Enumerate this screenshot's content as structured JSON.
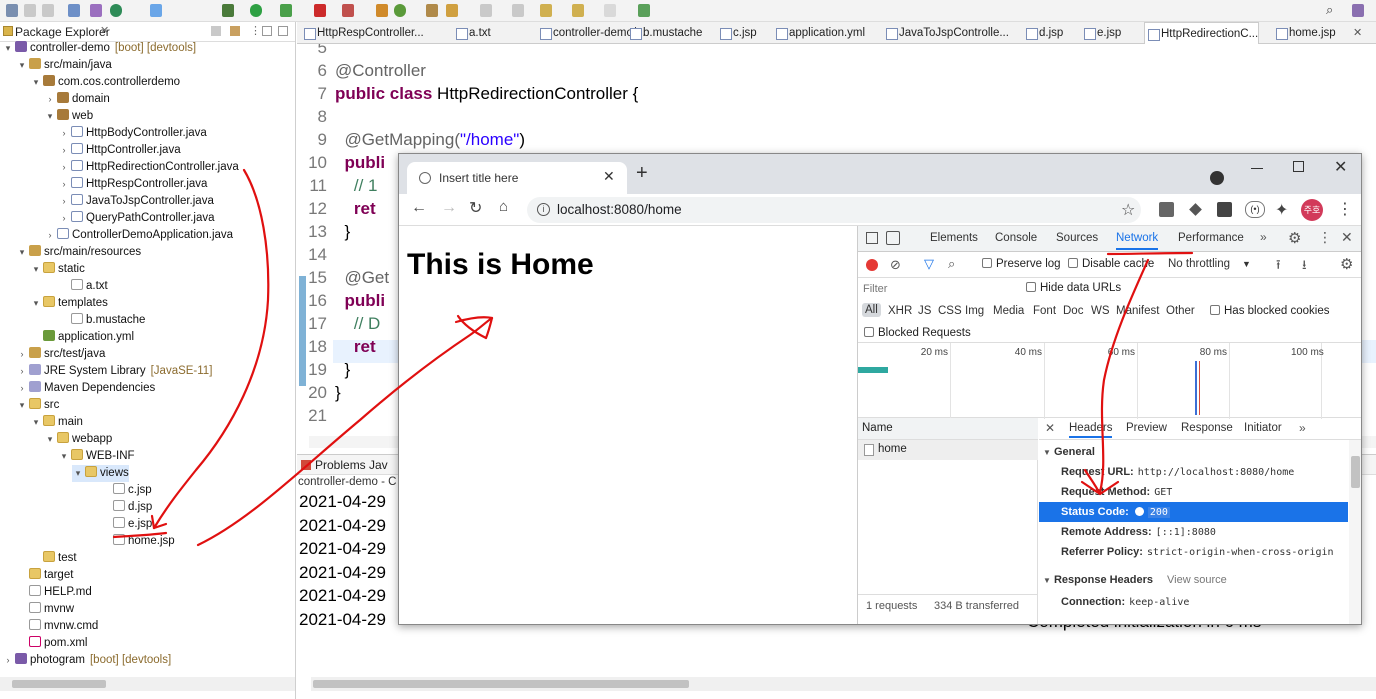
{
  "package_explorer": {
    "title": "Package Explorer",
    "items": [
      {
        "label": "controller-demo",
        "decor": "[boot] [devtools]"
      },
      {
        "label": "src/main/java"
      },
      {
        "label": "com.cos.controllerdemo"
      },
      {
        "label": "domain"
      },
      {
        "label": "web"
      },
      {
        "label": "HttpBodyController.java"
      },
      {
        "label": "HttpController.java"
      },
      {
        "label": "HttpRedirectionController.java"
      },
      {
        "label": "HttpRespController.java"
      },
      {
        "label": "JavaToJspController.java"
      },
      {
        "label": "QueryPathController.java"
      },
      {
        "label": "ControllerDemoApplication.java"
      },
      {
        "label": "src/main/resources"
      },
      {
        "label": "static"
      },
      {
        "label": "a.txt"
      },
      {
        "label": "templates"
      },
      {
        "label": "b.mustache"
      },
      {
        "label": "application.yml"
      },
      {
        "label": "src/test/java"
      },
      {
        "label": "JRE System Library",
        "decor": "[JavaSE-11]"
      },
      {
        "label": "Maven Dependencies"
      },
      {
        "label": "src"
      },
      {
        "label": "main"
      },
      {
        "label": "webapp"
      },
      {
        "label": "WEB-INF"
      },
      {
        "label": "views"
      },
      {
        "label": "c.jsp"
      },
      {
        "label": "d.jsp"
      },
      {
        "label": "e.jsp"
      },
      {
        "label": "home.jsp"
      },
      {
        "label": "test"
      },
      {
        "label": "target"
      },
      {
        "label": "HELP.md"
      },
      {
        "label": "mvnw"
      },
      {
        "label": "mvnw.cmd"
      },
      {
        "label": "pom.xml"
      },
      {
        "label": "photogram",
        "decor": "[boot] [devtools]"
      }
    ]
  },
  "editor_tabs": [
    "HttpRespController...",
    "a.txt",
    "controller-demo/...",
    "b.mustache",
    "c.jsp",
    "application.yml",
    "JavaToJspControlle...",
    "d.jsp",
    "e.jsp",
    "HttpRedirectionC...",
    "home.jsp"
  ],
  "editor": {
    "lines": [
      {
        "num": "5",
        "parts": []
      },
      {
        "num": "6",
        "parts": [
          {
            "t": "@Controller",
            "c": "ann"
          }
        ]
      },
      {
        "num": "7",
        "parts": [
          {
            "t": "public class ",
            "c": "kw"
          },
          {
            "t": "HttpRedirectionController {",
            "c": ""
          }
        ]
      },
      {
        "num": "8",
        "parts": []
      },
      {
        "num": "9",
        "parts": [
          {
            "t": "  @GetMapping(",
            "c": "ann"
          },
          {
            "t": "\"/home\"",
            "c": "str"
          },
          {
            "t": ")",
            "c": ""
          }
        ]
      },
      {
        "num": "10",
        "parts": [
          {
            "t": "  publi",
            "c": "kw"
          }
        ]
      },
      {
        "num": "11",
        "parts": [
          {
            "t": "    // 1",
            "c": "cm"
          }
        ]
      },
      {
        "num": "12",
        "parts": [
          {
            "t": "    ret",
            "c": "kw"
          }
        ]
      },
      {
        "num": "13",
        "parts": [
          {
            "t": "  }",
            "c": ""
          }
        ]
      },
      {
        "num": "14",
        "parts": []
      },
      {
        "num": "15",
        "parts": [
          {
            "t": "  @Get",
            "c": "ann"
          }
        ]
      },
      {
        "num": "16",
        "parts": [
          {
            "t": "  publi",
            "c": "kw"
          }
        ]
      },
      {
        "num": "17",
        "parts": [
          {
            "t": "    // D",
            "c": "cm"
          }
        ]
      },
      {
        "num": "18",
        "parts": [
          {
            "t": "    ret",
            "c": "kw"
          }
        ]
      },
      {
        "num": "19",
        "parts": [
          {
            "t": "  }",
            "c": ""
          }
        ]
      },
      {
        "num": "20",
        "parts": [
          {
            "t": "}",
            "c": ""
          }
        ]
      },
      {
        "num": "21",
        "parts": []
      }
    ]
  },
  "console": {
    "tabs": [
      "Problems",
      "Jav"
    ],
    "header": "controller-demo - C",
    "lines": [
      "2021-04-29",
      "2021-04-29",
      "2021-04-29",
      "2021-04-29",
      "2021-04-29",
      "2021-04-29"
    ],
    "last_line_suffix": "Completed initialization in 6 ms"
  },
  "browser": {
    "tab_title": "Insert title here",
    "url": "localhost:8080/home",
    "avatar_text": "주호",
    "page_heading": "This is Home",
    "devtools": {
      "tabs": [
        "Elements",
        "Console",
        "Sources",
        "Network",
        "Performance"
      ],
      "active_tab": "Network",
      "preserve_log": "Preserve log",
      "disable_cache": "Disable cache",
      "throttling": "No throttling",
      "filter_placeholder": "Filter",
      "hide_data_urls": "Hide data URLs",
      "type_filters": [
        "All",
        "XHR",
        "JS",
        "CSS",
        "Img",
        "Media",
        "Font",
        "Doc",
        "WS",
        "Manifest",
        "Other"
      ],
      "has_blocked_cookies": "Has blocked cookies",
      "blocked_requests": "Blocked Requests",
      "timeline_ticks": [
        "20 ms",
        "40 ms",
        "60 ms",
        "80 ms",
        "100 ms"
      ],
      "name_header": "Name",
      "requests": [
        "home"
      ],
      "status_bar": {
        "requests": "1 requests",
        "transferred": "334 B transferred"
      },
      "detail_tabs": [
        "Headers",
        "Preview",
        "Response",
        "Initiator"
      ],
      "general_title": "General",
      "general": [
        {
          "key": "Request URL:",
          "value": "http://localhost:8080/home"
        },
        {
          "key": "Request Method:",
          "value": "GET"
        },
        {
          "key": "Status Code:",
          "value": "200"
        },
        {
          "key": "Remote Address:",
          "value": "[::1]:8080"
        },
        {
          "key": "Referrer Policy:",
          "value": "strict-origin-when-cross-origin"
        }
      ],
      "response_headers_title": "Response Headers",
      "view_source": "View source",
      "response_headers": [
        {
          "key": "Connection:",
          "value": "keep-alive"
        }
      ]
    }
  },
  "colors": {
    "annotation": "#e01010",
    "selection": "#1a73e8",
    "accent": "#1a73e8",
    "record": "#e53935"
  }
}
